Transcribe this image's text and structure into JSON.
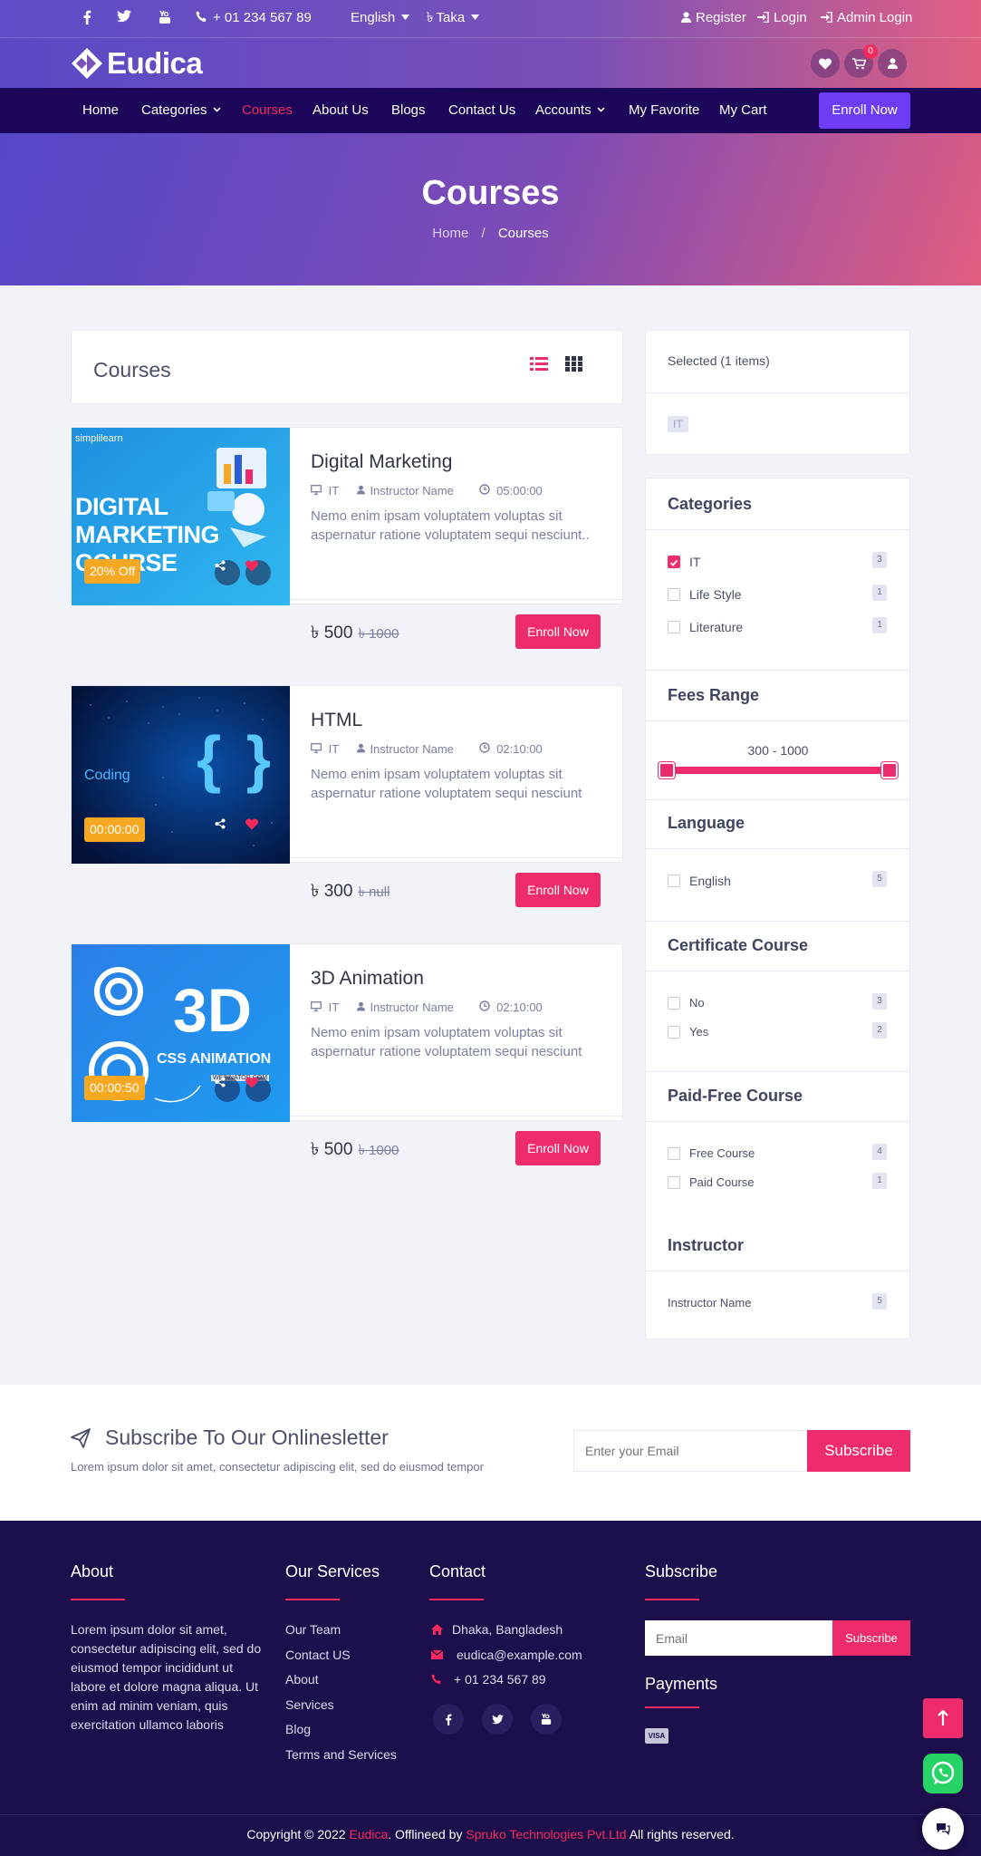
{
  "topbar": {
    "phone": "+ 01 234 567 89",
    "language": "English",
    "currency": "Taka",
    "register": "Register",
    "login": "Login",
    "admin_login": "Admin Login"
  },
  "brand": {
    "name": "Eudica"
  },
  "header_icons": {
    "cart_count": "0"
  },
  "nav": {
    "home": "Home",
    "categories": "Categories",
    "courses": "Courses",
    "about": "About Us",
    "blogs": "Blogs",
    "contact": "Contact Us",
    "accounts": "Accounts",
    "favorite": "My Favorite",
    "cart": "My Cart",
    "enroll": "Enroll Now"
  },
  "hero": {
    "title": "Courses",
    "crumb_home": "Home",
    "crumb_sep": "/",
    "crumb_current": "Courses"
  },
  "list_header": {
    "title": "Courses"
  },
  "courses": [
    {
      "title": "Digital Marketing",
      "category": "IT",
      "instructor": "Instructor Name",
      "duration": "05:00:00",
      "description": "Nemo enim ipsam voluptatem voluptas sit aspernatur ratione voluptatem sequi nesciunt..",
      "price": "৳ 500",
      "old_price": "৳ 1000",
      "tag": "20% Off",
      "enroll": "Enroll Now",
      "thumb_brand": "simplilearn",
      "thumb_lines": [
        "DIGITAL",
        "MARKETING",
        "COURSE"
      ]
    },
    {
      "title": "HTML",
      "category": "IT",
      "instructor": "Instructor Name",
      "duration": "02:10:00",
      "description": "Nemo enim ipsam voluptatem voluptas sit aspernatur ratione voluptatem sequi nesciunt",
      "price": "৳ 300",
      "old_price": "৳ null",
      "tag": "00:00:00",
      "enroll": "Enroll Now",
      "thumb_word": "Coding",
      "thumb_glyph": "{ }"
    },
    {
      "title": "3D Animation",
      "category": "IT",
      "instructor": "Instructor Name",
      "duration": "02:10:00",
      "description": "Nemo enim ipsam voluptatem voluptas sit aspernatur ratione voluptatem sequi nesciunt",
      "price": "৳ 500",
      "old_price": "৳ 1000",
      "tag": "00:00:50",
      "enroll": "Enroll Now",
      "thumb_big": "3D",
      "thumb_sub": "CSS ANIMATION",
      "thumb_small": "WEBINATOR.COM"
    }
  ],
  "sidebar": {
    "selected_title": "Selected (1 items)",
    "selected_chip": "IT",
    "categories_title": "Categories",
    "categories": [
      {
        "label": "IT",
        "count": "3",
        "checked": true
      },
      {
        "label": "Life Style",
        "count": "1",
        "checked": false
      },
      {
        "label": "Literature",
        "count": "1",
        "checked": false
      }
    ],
    "fees_title": "Fees Range",
    "fees_range": "300 - 1000",
    "fees_min": 300,
    "fees_max": 1000,
    "language_title": "Language",
    "languages": [
      {
        "label": "English",
        "count": "5"
      }
    ],
    "certificate_title": "Certificate Course",
    "certificate": [
      {
        "label": "No",
        "count": "3"
      },
      {
        "label": "Yes",
        "count": "2"
      }
    ],
    "paid_title": "Paid-Free Course",
    "paid": [
      {
        "label": "Free Course",
        "count": "4"
      },
      {
        "label": "Paid Course",
        "count": "1"
      }
    ],
    "instructor_title": "Instructor",
    "instructors": [
      {
        "label": "Instructor Name",
        "count": "5"
      }
    ]
  },
  "newsletter": {
    "title": "Subscribe To Our Onlinesletter",
    "text": "Lorem ipsum dolor sit amet, consectetur adipiscing elit, sed do eiusmod tempor",
    "placeholder": "Enter your Email",
    "button": "Subscribe"
  },
  "footer": {
    "about_title": "About",
    "about_text": "Lorem ipsum dolor sit amet, consectetur adipiscing elit, sed do eiusmod tempor incididunt ut labore et dolore magna aliqua. Ut enim ad minim veniam, quis exercitation ullamco laboris",
    "services_title": "Our Services",
    "services": [
      "Our Team",
      "Contact US",
      "About",
      "Services",
      "Blog",
      "Terms and Services"
    ],
    "contact_title": "Contact",
    "address": "Dhaka, Bangladesh",
    "email": "eudica@example.com",
    "phone": "+ 01 234 567 89",
    "subscribe_title": "Subscribe",
    "subscribe_placeholder": "Email",
    "subscribe_button": "Subscribe",
    "payments_title": "Payments",
    "card_label": "VISA",
    "copyright_pre": "Copyright © 2022",
    "copyright_brand": "Eudica",
    "copyright_mid": ". Offlineed by",
    "copyright_company": "Spruko Technologies Pvt.Ltd",
    "copyright_post": "All rights reserved."
  },
  "colors": {
    "accent": "#ee2c6c",
    "nav_bg": "#1b0659",
    "footer_bg": "#1d0e4c",
    "enroll_top": "#6c3df5",
    "tag": "#f6a823"
  }
}
